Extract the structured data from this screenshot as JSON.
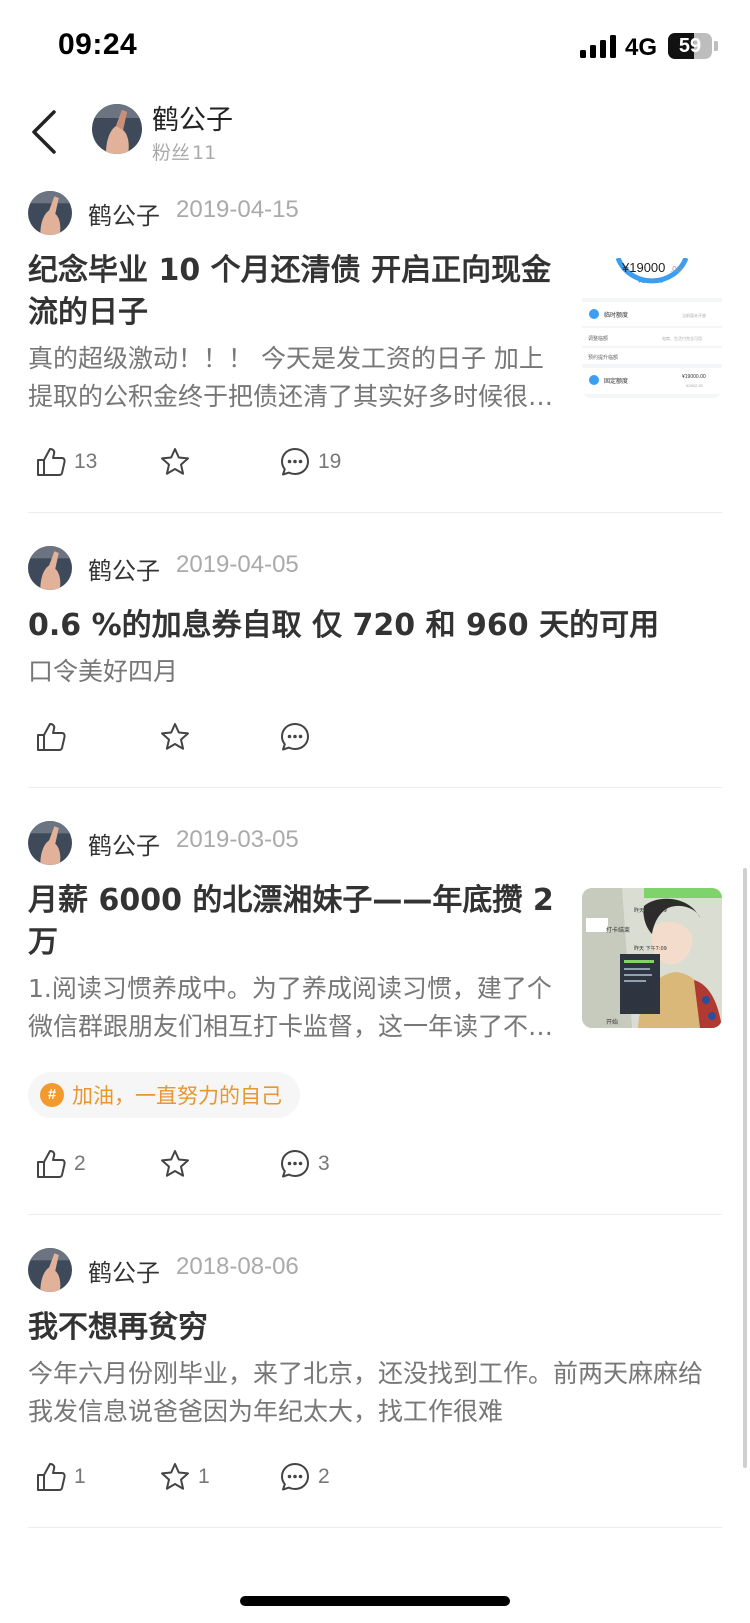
{
  "status_bar": {
    "time": "09:24",
    "network": "4G",
    "battery": "59",
    "battery_level": 0.59
  },
  "header": {
    "back_icon": "chevron-left-icon",
    "name": "鹤公子",
    "fans_label": "粉丝",
    "fans_count": "11"
  },
  "posts": [
    {
      "author": "鹤公子",
      "date": "2019-04-15",
      "title": "纪念毕业 10 个月还清债  开启正向现金流的日子",
      "excerpt": "真的超级激动！！！ 今天是发工资的日子 加上提取的公积金终于把债还清了其实好多时候很害怕的怕会一直还不清",
      "thumbnail": {
        "amount": "¥19000",
        "amount_decimals": ".00",
        "sub_amount": "¥2802.35",
        "rows": [
          "临时额度",
          "调整临额",
          "预约提升临额",
          "固定额度"
        ],
        "row_right": [
          "当前暂未开放",
          "电商、生活付完全可用",
          "",
          "¥19000.00"
        ],
        "row_right_sub": "¥2802.35"
      },
      "likes": "13",
      "comments": "19"
    },
    {
      "author": "鹤公子",
      "date": "2019-04-05",
      "title": "0.6 %的加息券自取 仅 720 和 960 天的可用",
      "excerpt": "口令美好四月",
      "likes": "",
      "comments": ""
    },
    {
      "author": "鹤公子",
      "date": "2019-03-05",
      "title": "月薪 6000 的北漂湘妹子——年底攒 2万",
      "excerpt": "1.阅读习惯养成中。为了养成阅读习惯，建了个微信群跟朋友们相互打卡监督，这一年读了不少书",
      "thumbnail": {
        "labels": [
          "打卡结束",
          "昨天 下午7:09",
          "昨天 下午7:09",
          "开始"
        ]
      },
      "topic": "加油，一直努力的自己",
      "topic_icon": "hashtag-icon",
      "likes": "2",
      "comments": "3"
    },
    {
      "author": "鹤公子",
      "date": "2018-08-06",
      "title": "我不想再贫穷",
      "excerpt": "今年六月份刚毕业，来了北京，还没找到工作。前两天麻麻给我发信息说爸爸因为年纪太大，找工作很难",
      "likes": "1",
      "favorites": "1",
      "comments": "2"
    }
  ],
  "colors": {
    "accent_orange": "#f29a2e",
    "text_primary": "#333333",
    "text_secondary": "#777777",
    "text_muted": "#aaaaaa"
  }
}
